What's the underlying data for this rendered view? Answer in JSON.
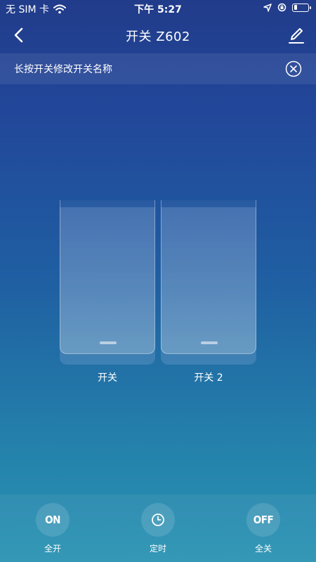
{
  "status_bar": {
    "carrier": "无 SIM 卡",
    "time": "下午 5:27"
  },
  "nav": {
    "title": "开关 Z602"
  },
  "tip": {
    "text": "长按开关修改开关名称"
  },
  "switches": [
    {
      "label": "开关"
    },
    {
      "label": "开关 2"
    }
  ],
  "actions": [
    {
      "icon_text": "ON",
      "label": "全开"
    },
    {
      "icon": "clock-icon",
      "label": "定时"
    },
    {
      "icon_text": "OFF",
      "label": "全关"
    }
  ]
}
